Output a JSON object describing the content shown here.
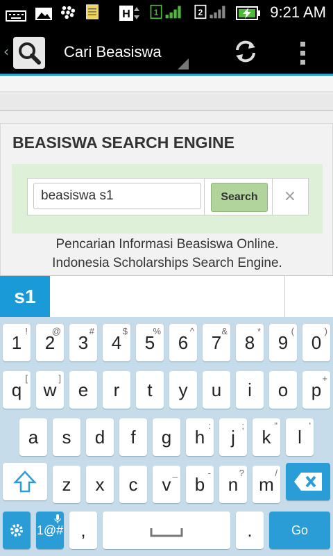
{
  "status_bar": {
    "time": "9:21 AM",
    "icons": [
      "keyboard-icon",
      "gallery-icon",
      "blackberry-icon",
      "notes-icon",
      "h-network-icon",
      "sim1-signal-icon",
      "sim2-signal-icon",
      "battery-charging-icon"
    ]
  },
  "action_bar": {
    "title": "Cari Beasiswa",
    "icons": [
      "back-chevron-icon",
      "search-app-icon",
      "refresh-icon",
      "overflow-menu-icon"
    ]
  },
  "page": {
    "title": "BEASISWA SEARCH ENGINE",
    "search_value": "beasiswa s1",
    "search_button": "Search",
    "clear_label": "×",
    "tagline_1": "Pencarian Informasi Beasiswa Online.",
    "tagline_2": "Indonesia Scholarships Search Engine."
  },
  "suggestions": {
    "first": "s1"
  },
  "keyboard": {
    "row1": [
      {
        "k": "1",
        "s": "!"
      },
      {
        "k": "2",
        "s": "@"
      },
      {
        "k": "3",
        "s": "#"
      },
      {
        "k": "4",
        "s": "$"
      },
      {
        "k": "5",
        "s": "%"
      },
      {
        "k": "6",
        "s": "^"
      },
      {
        "k": "7",
        "s": "&"
      },
      {
        "k": "8",
        "s": "*"
      },
      {
        "k": "9",
        "s": "("
      },
      {
        "k": "0",
        "s": ")"
      }
    ],
    "row2": [
      {
        "k": "q",
        "s": "["
      },
      {
        "k": "w",
        "s": "]"
      },
      {
        "k": "e",
        "s": ""
      },
      {
        "k": "r",
        "s": ""
      },
      {
        "k": "t",
        "s": ""
      },
      {
        "k": "y",
        "s": ""
      },
      {
        "k": "u",
        "s": ""
      },
      {
        "k": "i",
        "s": ""
      },
      {
        "k": "o",
        "s": ""
      },
      {
        "k": "p",
        "s": "+"
      }
    ],
    "row3": [
      {
        "k": "a",
        "s": ""
      },
      {
        "k": "s",
        "s": ""
      },
      {
        "k": "d",
        "s": ""
      },
      {
        "k": "f",
        "s": ""
      },
      {
        "k": "g",
        "s": ""
      },
      {
        "k": "h",
        "s": ":"
      },
      {
        "k": "j",
        "s": ";"
      },
      {
        "k": "k",
        "s": "\""
      },
      {
        "k": "l",
        "s": "'"
      }
    ],
    "row4": [
      {
        "k": "z",
        "s": ""
      },
      {
        "k": "x",
        "s": ""
      },
      {
        "k": "c",
        "s": ""
      },
      {
        "k": "v",
        "s": "_"
      },
      {
        "k": "b",
        "s": "-"
      },
      {
        "k": "n",
        "s": "?"
      },
      {
        "k": "m",
        "s": "/"
      }
    ],
    "symbols_label": "1@#",
    "comma": ",",
    "period": ".",
    "go_label": "Go",
    "icons": [
      "shift-arrow-icon",
      "backspace-icon",
      "settings-gear-icon",
      "microphone-icon",
      "spacebar-icon"
    ]
  },
  "colors": {
    "accent": "#2a9fd8",
    "search_button": "#b0d49c",
    "well": "#dff0d8",
    "keyboard_bg": "#c6dcea",
    "key_blue": "#2b9dd6"
  }
}
